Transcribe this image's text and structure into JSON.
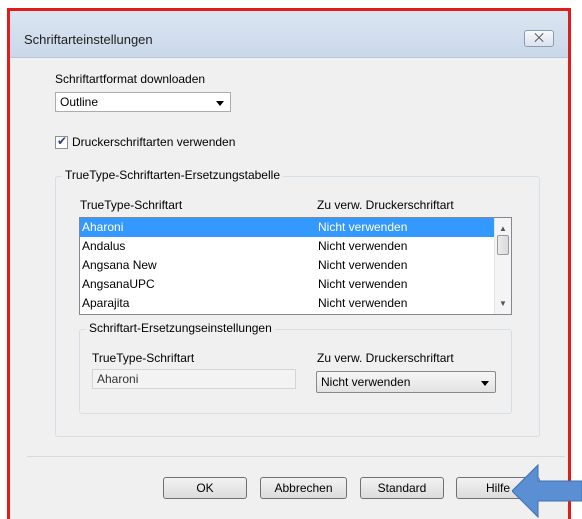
{
  "dialog": {
    "title": "Schriftarteinstellungen",
    "close_label": "⨉"
  },
  "download_format": {
    "label": "Schriftartformat downloaden",
    "value": "Outline"
  },
  "use_printer_fonts": {
    "label": "Druckerschriftarten verwenden",
    "checked": true
  },
  "substitution_table": {
    "group_title": "TrueType-Schriftarten-Ersetzungstabelle",
    "columns": [
      "TrueType-Schriftart",
      "Zu verw. Druckerschriftart"
    ],
    "rows": [
      {
        "font": "Aharoni",
        "printer_font": "Nicht verwenden",
        "selected": true
      },
      {
        "font": "Andalus",
        "printer_font": "Nicht verwenden"
      },
      {
        "font": "Angsana New",
        "printer_font": "Nicht verwenden"
      },
      {
        "font": "AngsanaUPC",
        "printer_font": "Nicht verwenden"
      },
      {
        "font": "Aparajita",
        "printer_font": "Nicht verwenden"
      }
    ]
  },
  "substitution_settings": {
    "group_title": "Schriftart-Ersetzungseinstellungen",
    "truetype_label": "TrueType-Schriftart",
    "truetype_value": "Aharoni",
    "printer_label": "Zu verw. Druckerschriftart",
    "printer_value": "Nicht verwenden"
  },
  "buttons": {
    "ok": "OK",
    "cancel": "Abbrechen",
    "default": "Standard",
    "help": "Hilfe"
  },
  "colors": {
    "highlight": "#e21b1b",
    "selection": "#3399ff",
    "pointer_arrow": "#5b8fd3"
  }
}
